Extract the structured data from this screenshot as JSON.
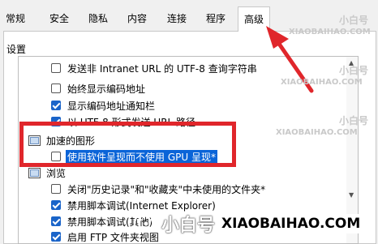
{
  "tabs": [
    {
      "label": "常规"
    },
    {
      "label": "安全"
    },
    {
      "label": "隐私"
    },
    {
      "label": "内容"
    },
    {
      "label": "连接"
    },
    {
      "label": "程序"
    },
    {
      "label": "高级",
      "active": true
    }
  ],
  "section_title": "设置",
  "settings_list": [
    {
      "label": "发送非 Intranet URL 的 UTF-8 查询字符串",
      "checked": false
    },
    {
      "label": "始终显示编码地址",
      "checked": false
    },
    {
      "label": "显示编码地址通知栏",
      "checked": true
    },
    {
      "label": "以 UTF-8 形式发送 URL 路径",
      "checked": true
    },
    {
      "group": "加速的图形",
      "icon": "folder-icon"
    },
    {
      "label": "使用软件呈现而不使用 GPU 呈现*",
      "checked": false,
      "selected": true
    },
    {
      "group": "浏览",
      "icon": "folder-icon"
    },
    {
      "label": "关闭\"历史记录\"和\"收藏夹\"中未使用的文件夹*",
      "checked": false
    },
    {
      "label": "禁用脚本调试(Internet Explorer)",
      "checked": true
    },
    {
      "label": "禁用脚本调试(其他)",
      "checked": true
    },
    {
      "label": "启用 FTP 文件夹视图",
      "checked": true
    }
  ],
  "watermark": {
    "brand_name": "小白号",
    "domain_text": "XIAOBAIHAO.COM"
  },
  "colors": {
    "annotation_red": "#e0262b",
    "selection_blue": "#0a64d8",
    "checkbox_blue": "#1a64c9"
  }
}
